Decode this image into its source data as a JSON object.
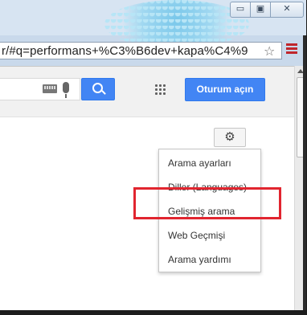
{
  "window": {
    "controls": [
      "minimize",
      "maximize",
      "close"
    ]
  },
  "address_bar": {
    "url": "r/#q=performans+%C3%B6dev+kapa%C4%9",
    "star_icon": "star-icon",
    "menu_icon": "menu-icon"
  },
  "toolbar": {
    "search_button_icon": "search-icon",
    "apps_icon": "apps-grid-icon",
    "signin_label": "Oturum açın"
  },
  "settings": {
    "gear_icon": "gear-icon",
    "menu_items": [
      "Arama ayarları",
      "Diller  (Languages)",
      "Gelişmiş arama",
      "Web Geçmişi",
      "Arama yardımı"
    ],
    "highlighted_index": 2,
    "highlight_color": "#e1252f"
  },
  "colors": {
    "accent_blue": "#4285f4",
    "menu_icon_red": "#c0262c"
  }
}
